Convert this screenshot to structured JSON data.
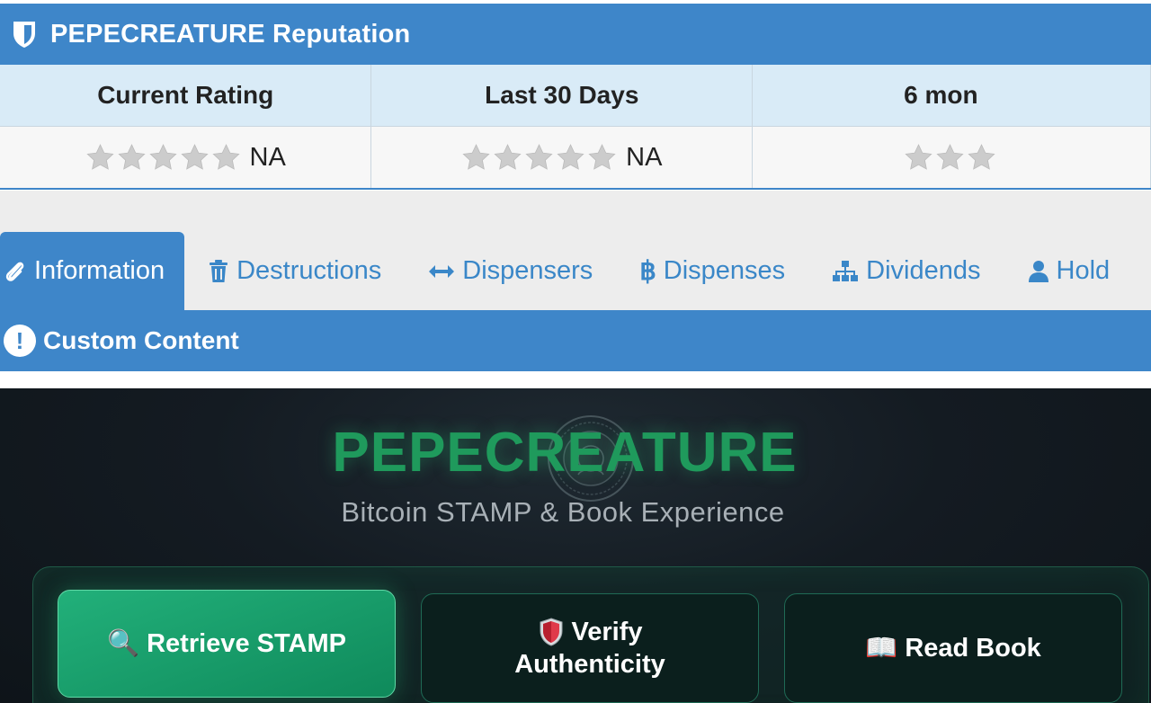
{
  "reputation": {
    "title": "PEPECREATURE Reputation",
    "columns": [
      {
        "header": "Current Rating",
        "value": "NA",
        "stars_filled": 0
      },
      {
        "header": "Last 30 Days",
        "value": "NA",
        "stars_filled": 0
      },
      {
        "header": "6 mon",
        "value": "",
        "stars_filled": 0
      }
    ]
  },
  "tabs": [
    {
      "label": "Information",
      "icon": "paperclip-icon",
      "active": true
    },
    {
      "label": "Destructions",
      "icon": "trash-icon",
      "active": false
    },
    {
      "label": "Dispensers",
      "icon": "arrows-horizontal-icon",
      "active": false
    },
    {
      "label": "Dispenses",
      "icon": "bitcoin-icon",
      "active": false
    },
    {
      "label": "Dividends",
      "icon": "sitemap-icon",
      "active": false
    },
    {
      "label": "Hold",
      "icon": "user-icon",
      "active": false
    }
  ],
  "custom": {
    "title": "Custom Content",
    "icon": "exclamation-circle-icon",
    "brand": "PEPECREATURE",
    "subtitle": "Bitcoin STAMP & Book Experience",
    "buttons": {
      "retrieve": {
        "emoji": "🔍",
        "label": "Retrieve STAMP"
      },
      "verify": {
        "emoji_line": "Verify",
        "line2": "Authenticity"
      },
      "read": {
        "emoji": "📖",
        "label": "Read Book"
      }
    }
  },
  "colors": {
    "primary_blue": "#3e86c9",
    "header_row": "#d9ebf7",
    "brand_green": "#1f9a5c",
    "button_green": "#0f8a5b",
    "dark_bg": "#141b22"
  }
}
